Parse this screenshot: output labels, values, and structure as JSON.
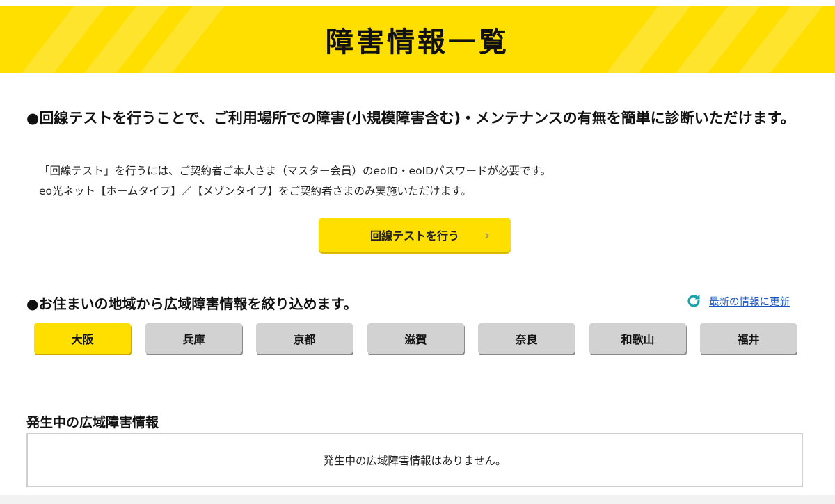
{
  "header": {
    "title": "障害情報一覧",
    "bg_color": "#ffdf00"
  },
  "section_line_test": {
    "title": "●回線テストを行うことで、ご利用場所での障害(小規模障害含む)・メンテナンスの有無を簡単に診断いただけます。",
    "note_1": "「回線テスト」を行うには、ご契約者ご本人さま（マスター会員）のeoID・eoIDパスワードが必要です。",
    "note_2": "eo光ネット【ホームタイプ】／【メゾンタイプ】をご契約者さまのみ実施いただけます。",
    "button_label": "回線テストを行う",
    "button_icon": "chevron-right-icon"
  },
  "section_region": {
    "title": "●お住まいの地域から広域障害情報を絞り込めます。",
    "refresh_label": "最新の情報に更新",
    "refresh_icon": "refresh-icon",
    "refresh_color": "#1aa3a8",
    "selected_tab": "大阪",
    "tabs": [
      "大阪",
      "兵庫",
      "京都",
      "滋賀",
      "奈良",
      "和歌山",
      "福井"
    ]
  },
  "section_current": {
    "title": "発生中の広域障害情報",
    "empty_message": "発生中の広域障害情報はありません。"
  }
}
